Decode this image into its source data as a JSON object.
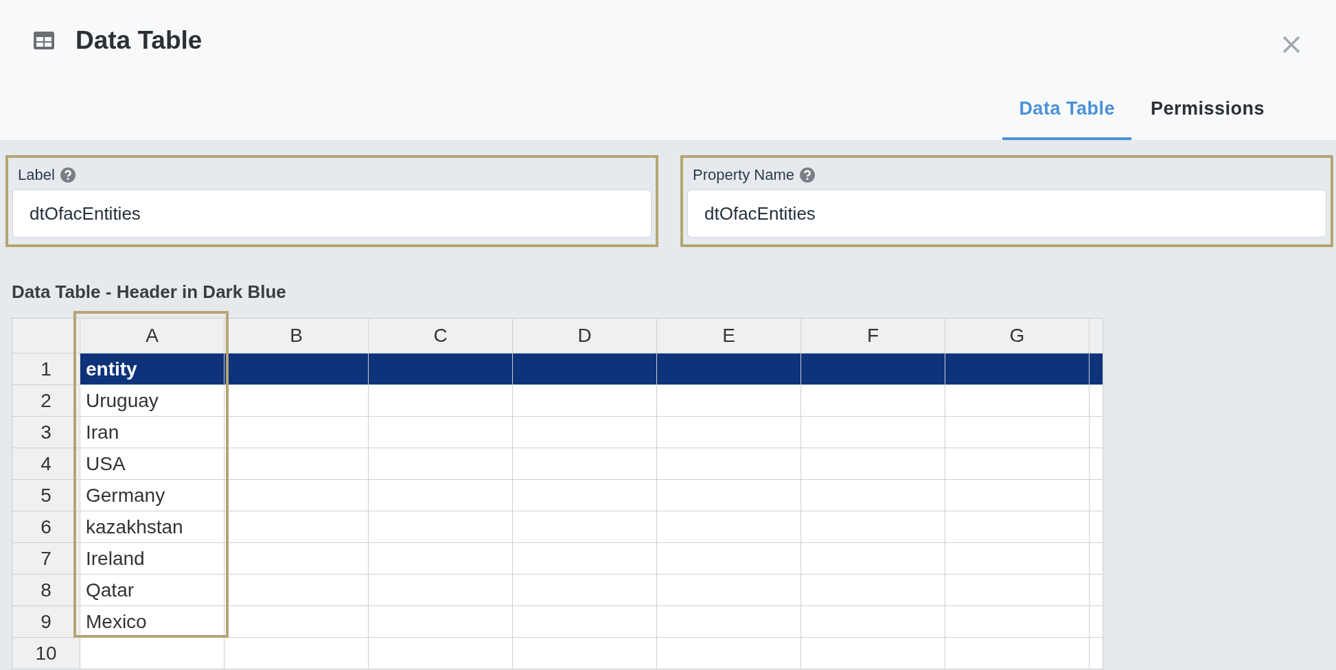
{
  "dialog": {
    "title": "Data Table",
    "tabs": [
      {
        "label": "Data Table",
        "selected": true
      },
      {
        "label": "Permissions",
        "selected": false
      }
    ]
  },
  "fields": [
    {
      "label": "Label",
      "value": "dtOfacEntities",
      "highlighted": true
    },
    {
      "label": "Property Name",
      "value": "dtOfacEntities",
      "highlighted": true
    }
  ],
  "table": {
    "title": "Data Table - Header in Dark Blue",
    "columns": [
      {
        "label": "A",
        "highlighted": true
      },
      {
        "label": "B",
        "highlighted": false
      },
      {
        "label": "C",
        "highlighted": false
      },
      {
        "label": "D",
        "highlighted": false
      },
      {
        "label": "E",
        "highlighted": false
      },
      {
        "label": "F",
        "highlighted": false
      },
      {
        "label": "G",
        "highlighted": false
      }
    ],
    "rows": [
      {
        "number": "1",
        "kind": "header",
        "cells": [
          "entity"
        ]
      },
      {
        "number": "2",
        "kind": "data",
        "cells": [
          "Uruguay"
        ]
      },
      {
        "number": "3",
        "kind": "data",
        "cells": [
          "Iran"
        ]
      },
      {
        "number": "4",
        "kind": "data",
        "cells": [
          "USA"
        ]
      },
      {
        "number": "5",
        "kind": "data",
        "cells": [
          "Germany"
        ]
      },
      {
        "number": "6",
        "kind": "data",
        "cells": [
          "kazakhstan"
        ]
      },
      {
        "number": "7",
        "kind": "data",
        "cells": [
          "Ireland"
        ]
      },
      {
        "number": "8",
        "kind": "data",
        "cells": [
          "Qatar"
        ]
      },
      {
        "number": "9",
        "kind": "data",
        "cells": [
          "Mexico"
        ]
      },
      {
        "number": "10",
        "kind": "data",
        "cells": []
      }
    ]
  }
}
